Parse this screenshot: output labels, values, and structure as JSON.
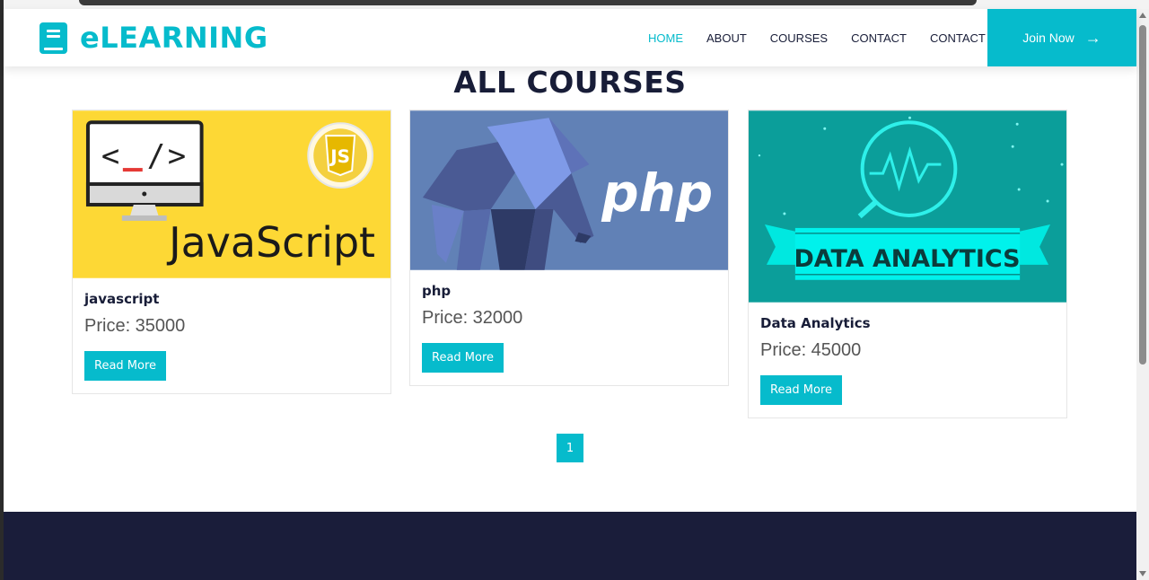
{
  "brand": {
    "name": "eLEARNING",
    "icon": "book-icon",
    "color": "#06BBCC"
  },
  "nav": {
    "items": [
      {
        "label": "HOME",
        "active": true
      },
      {
        "label": "ABOUT",
        "active": false
      },
      {
        "label": "COURSES",
        "active": false
      },
      {
        "label": "CONTACT",
        "active": false
      },
      {
        "label": "CONTACT",
        "active": false
      }
    ],
    "join_label": "Join Now",
    "join_icon": "arrow-right-icon"
  },
  "page": {
    "title": "ALL COURSES"
  },
  "courses": [
    {
      "title": "javascript",
      "price": "Price: 35000",
      "button": "Read More",
      "image_text": "JavaScript",
      "badge_text": "JS"
    },
    {
      "title": "php",
      "price": "Price: 32000",
      "button": "Read More",
      "image_text": "php"
    },
    {
      "title": "Data Analytics",
      "price": "Price: 45000",
      "button": "Read More",
      "image_text": "DATA ANALYTICS"
    }
  ],
  "pagination": {
    "current": "1"
  },
  "colors": {
    "accent": "#06BBCC",
    "dark": "#181d38",
    "footer": "#1a1d3a"
  }
}
